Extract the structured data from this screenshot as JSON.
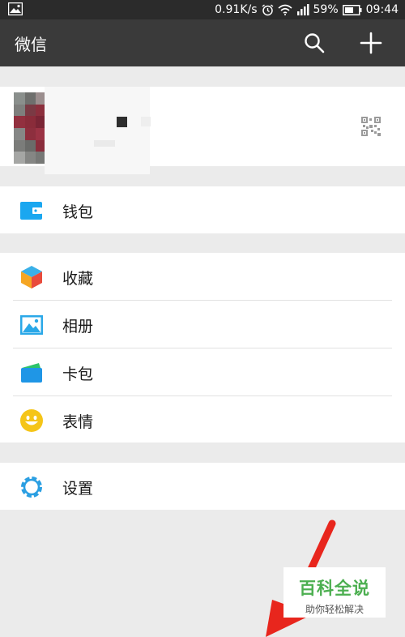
{
  "status_bar": {
    "speed": "0.91K/s",
    "battery": "59%",
    "time": "09:44"
  },
  "app_bar": {
    "title": "微信",
    "actions": [
      "search-icon",
      "plus-icon"
    ]
  },
  "profile": {
    "avatar": "pixelated-avatar",
    "qr_icon": "qr-code-icon"
  },
  "menu": {
    "wallet": {
      "label": "钱包",
      "icon": "wallet-icon",
      "color": "#1aa7f0"
    },
    "favorites": {
      "label": "收藏",
      "icon": "cube-icon"
    },
    "album": {
      "label": "相册",
      "icon": "picture-icon",
      "color": "#2aa8e8"
    },
    "cards": {
      "label": "卡包",
      "icon": "card-icon"
    },
    "stickers": {
      "label": "表情",
      "icon": "smiley-icon",
      "color": "#f5c518"
    },
    "settings": {
      "label": "设置",
      "icon": "gear-icon",
      "color": "#2b9fe2"
    }
  },
  "watermark": {
    "title": "百科全说",
    "subtitle": "助你轻松解决"
  },
  "colors": {
    "app_bar": "#3a3a3a",
    "status_bar": "#2b2b2b",
    "background": "#ebebeb",
    "arrow": "#e8261d",
    "watermark_green": "#4caf50"
  }
}
